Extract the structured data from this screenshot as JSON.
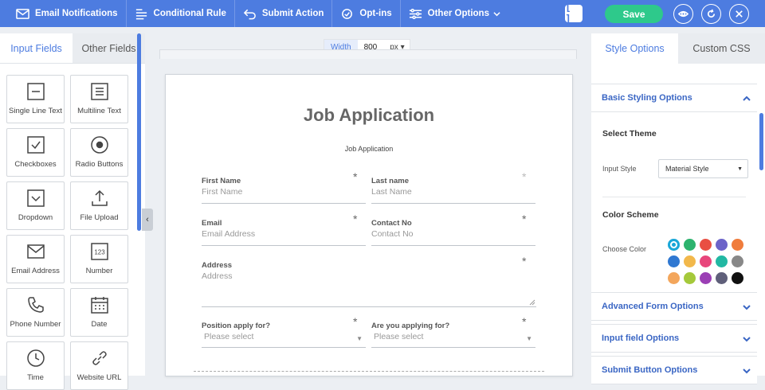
{
  "toolbar": {
    "items": [
      {
        "label": "Email Notifications",
        "icon": "envelope-icon"
      },
      {
        "label": "Conditional Rule",
        "icon": "rules-icon"
      },
      {
        "label": "Submit Action",
        "icon": "reply-icon"
      },
      {
        "label": "Opt-ins",
        "icon": "opt-ins-icon"
      },
      {
        "label": "Other Options",
        "icon": "sliders-icon"
      }
    ],
    "bracket_label": "[ ]",
    "save_label": "Save"
  },
  "left_panel": {
    "tabs": [
      "Input Fields",
      "Other Fields"
    ],
    "fields": [
      {
        "label": "Single Line Text",
        "icon": "single-line-text-icon"
      },
      {
        "label": "Multiline Text",
        "icon": "multiline-text-icon"
      },
      {
        "label": "Checkboxes",
        "icon": "checkbox-icon"
      },
      {
        "label": "Radio Buttons",
        "icon": "radio-button-icon"
      },
      {
        "label": "Dropdown",
        "icon": "dropdown-icon"
      },
      {
        "label": "File Upload",
        "icon": "upload-icon"
      },
      {
        "label": "Email Address",
        "icon": "envelope-icon"
      },
      {
        "label": "Number",
        "icon": "number-icon"
      },
      {
        "label": "Phone Number",
        "icon": "phone-icon"
      },
      {
        "label": "Date",
        "icon": "calendar-icon"
      },
      {
        "label": "Time",
        "icon": "clock-icon"
      },
      {
        "label": "Website URL",
        "icon": "link-icon"
      }
    ]
  },
  "width_bar": {
    "label": "Width",
    "value": "800",
    "unit": "px ▾"
  },
  "form": {
    "title": "Job Application",
    "subtitle": "Job Application",
    "fields": {
      "first_name": {
        "label": "First Name",
        "placeholder": "First Name"
      },
      "last_name": {
        "label": "Last name",
        "placeholder": "Last Name"
      },
      "email": {
        "label": "Email",
        "placeholder": "Email Address"
      },
      "contact": {
        "label": "Contact No",
        "placeholder": "Contact No"
      },
      "address": {
        "label": "Address",
        "placeholder": "Address"
      },
      "position": {
        "label": "Position apply for?",
        "placeholder": "Please select"
      },
      "applying": {
        "label": "Are you applying for?",
        "placeholder": "Please select"
      }
    },
    "required_mark": "*"
  },
  "right_panel": {
    "tabs": [
      "Style Options",
      "Custom CSS"
    ],
    "basic_section": "Basic Styling Options",
    "select_theme": "Select Theme",
    "input_style_label": "Input Style",
    "input_style_value": "Material Style",
    "color_scheme": "Color Scheme",
    "choose_color": "Choose Color",
    "swatches": [
      "#1aa7d8",
      "#2db36e",
      "#e94f43",
      "#6c63c9",
      "#f07c3c",
      "#2f78d1",
      "#f2b84b",
      "#e8467c",
      "#22b8a3",
      "#888888",
      "#f3a65c",
      "#a5c93b",
      "#9b3fb5",
      "#5f5f7a",
      "#111111"
    ],
    "sections": [
      "Advanced Form Options",
      "Input field Options",
      "Submit Button Options"
    ]
  }
}
